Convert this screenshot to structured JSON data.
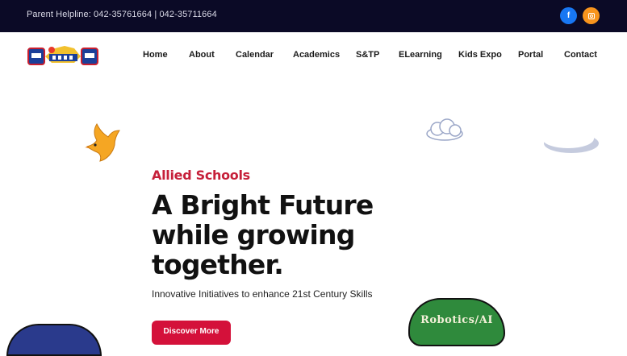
{
  "topbar": {
    "helpline": "Parent Helpline: 042-35761664 | 042-35711664",
    "social": [
      {
        "name": "facebook-icon",
        "glyph": "f",
        "color": "#1877f2"
      },
      {
        "name": "instagram-icon",
        "color": "#f7941d"
      }
    ]
  },
  "nav": {
    "items": [
      "Home",
      "About",
      "Calendar",
      "Academics",
      "S&TP",
      "ELearning",
      "Kids Expo",
      "Portal",
      "Contact"
    ]
  },
  "hero": {
    "subtitle": "Allied Schools",
    "title": "A Bright Future while growing together.",
    "description": "Innovative Initiatives to enhance 21st Century Skills",
    "cta": "Discover More"
  },
  "decor": {
    "robotics_label": "Robotics/AI"
  },
  "colors": {
    "topbar_bg": "#0b0a26",
    "accent_red": "#d4113a",
    "subtitle_red": "#c6203a",
    "robotics_green": "#2f8a3c",
    "blob_blue": "#2a3a8c"
  }
}
